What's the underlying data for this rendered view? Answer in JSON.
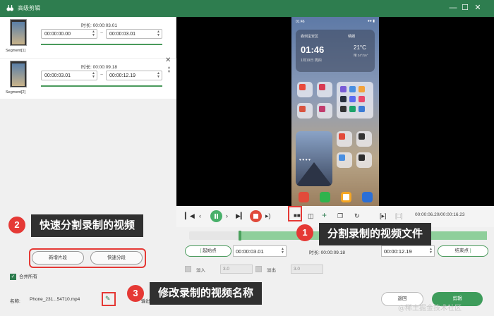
{
  "window": {
    "title": "高级剪辑",
    "colors": {
      "titlebar": "#2e7d4f",
      "accent": "#3e9c5b",
      "highlight": "#e53935"
    }
  },
  "segments": [
    {
      "label": "Segment[1]",
      "duration_label": "时长:",
      "duration": "00:00:03.01",
      "start": "00:00:00.00",
      "end": "00:00:03.01"
    },
    {
      "label": "Segment[2]",
      "duration_label": "时长:",
      "duration": "00:00:09.18",
      "start": "00:00:03.01",
      "end": "00:00:12.19"
    }
  ],
  "phone": {
    "status_time": "01:46",
    "city": "森圳宝安区",
    "weather": "晴朗",
    "clock": "01:46",
    "date": "1月19日 周四",
    "temp": "21°C",
    "weather_detail": "晴 24°/16°"
  },
  "player": {
    "time_readout": "00:00:06.20/00:00:16.23"
  },
  "trim": {
    "start_label": "起始点",
    "start_time": "00:00:03.01",
    "duration_label": "时长:",
    "duration": "00:00:09.18",
    "end_time": "00:00:12.19",
    "end_label": "结束点"
  },
  "fade": {
    "in_label": "淡入",
    "in_value": "3.0",
    "out_label": "淡出",
    "out_value": "3.0"
  },
  "buttons": {
    "new_segment": "新增片段",
    "quick_split": "快速分段",
    "merge_all": "合并所有",
    "back": "返回",
    "edit": "剪辑"
  },
  "file": {
    "name_label": "名称:",
    "name_value": "Phone_231...54710.mp4",
    "output_label": "输出:"
  },
  "annotations": [
    {
      "number": "1",
      "text": "分割录制的视频文件"
    },
    {
      "number": "2",
      "text": "快速分割录制的视频"
    },
    {
      "number": "3",
      "text": "修改录制的视频名称"
    }
  ],
  "watermark": "@稀土掘金技术社区"
}
